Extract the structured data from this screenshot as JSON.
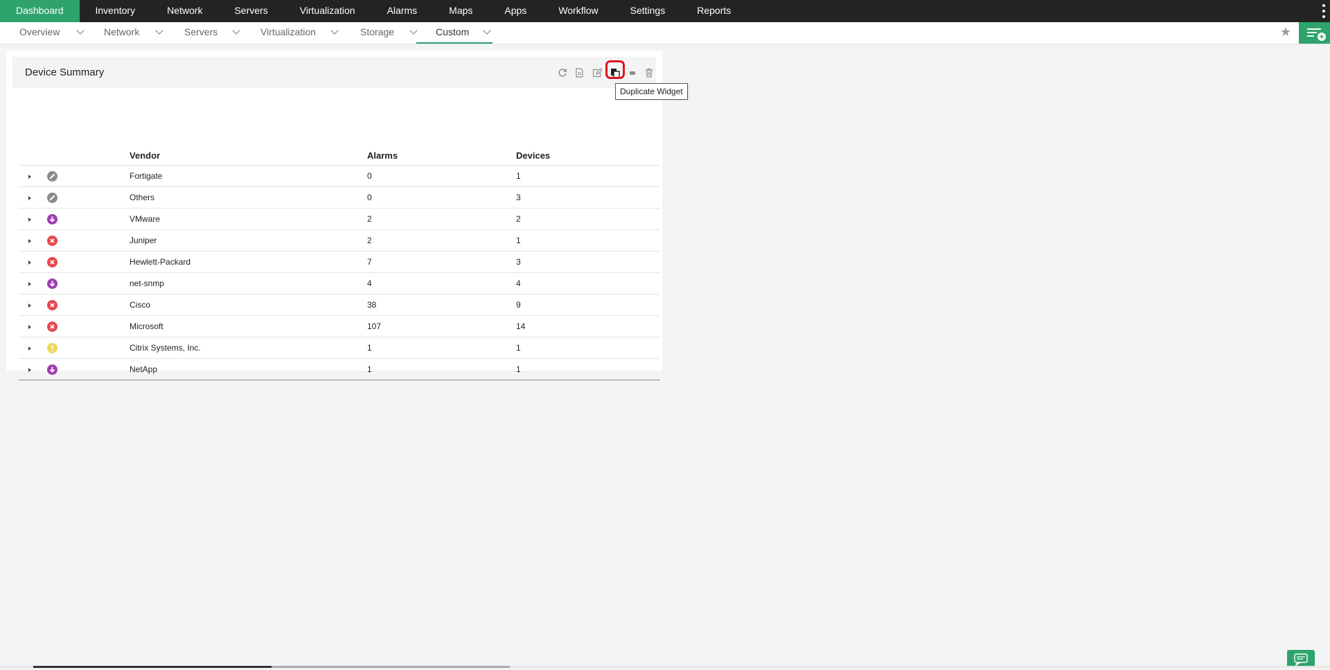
{
  "topnav": {
    "items": [
      {
        "label": "Dashboard",
        "active": true
      },
      {
        "label": "Inventory"
      },
      {
        "label": "Network"
      },
      {
        "label": "Servers"
      },
      {
        "label": "Virtualization"
      },
      {
        "label": "Alarms"
      },
      {
        "label": "Maps"
      },
      {
        "label": "Apps"
      },
      {
        "label": "Workflow"
      },
      {
        "label": "Settings"
      },
      {
        "label": "Reports"
      }
    ]
  },
  "subnav": {
    "tabs": [
      {
        "label": "Overview"
      },
      {
        "label": "Network"
      },
      {
        "label": "Servers"
      },
      {
        "label": "Virtualization"
      },
      {
        "label": "Storage"
      },
      {
        "label": "Custom",
        "active": true
      }
    ]
  },
  "widget": {
    "title": "Device Summary",
    "tooltip": "Duplicate Widget",
    "columns": [
      "Vendor",
      "Alarms",
      "Devices"
    ],
    "rows": [
      {
        "status": "unknown",
        "vendor": "Fortigate",
        "alarms": "0",
        "devices": "1"
      },
      {
        "status": "unknown",
        "vendor": "Others",
        "alarms": "0",
        "devices": "3"
      },
      {
        "status": "down",
        "vendor": "VMware",
        "alarms": "2",
        "devices": "2"
      },
      {
        "status": "critical",
        "vendor": "Juniper",
        "alarms": "2",
        "devices": "1"
      },
      {
        "status": "critical",
        "vendor": "Hewlett-Packard",
        "alarms": "7",
        "devices": "3"
      },
      {
        "status": "down",
        "vendor": "net-snmp",
        "alarms": "4",
        "devices": "4"
      },
      {
        "status": "critical",
        "vendor": "Cisco",
        "alarms": "38",
        "devices": "9"
      },
      {
        "status": "critical",
        "vendor": "Microsoft",
        "alarms": "107",
        "devices": "14"
      },
      {
        "status": "warning",
        "vendor": "Citrix Systems, Inc.",
        "alarms": "1",
        "devices": "1"
      },
      {
        "status": "down",
        "vendor": "NetApp",
        "alarms": "1",
        "devices": "1"
      }
    ]
  },
  "colors": {
    "accent": "#2ea36b",
    "nav_bg": "#232323",
    "status_unknown": "#8a8a8a",
    "status_down": "#a03cb4",
    "status_critical": "#e5484d",
    "status_warning": "#ecd65a",
    "highlight": "#e0141b"
  }
}
